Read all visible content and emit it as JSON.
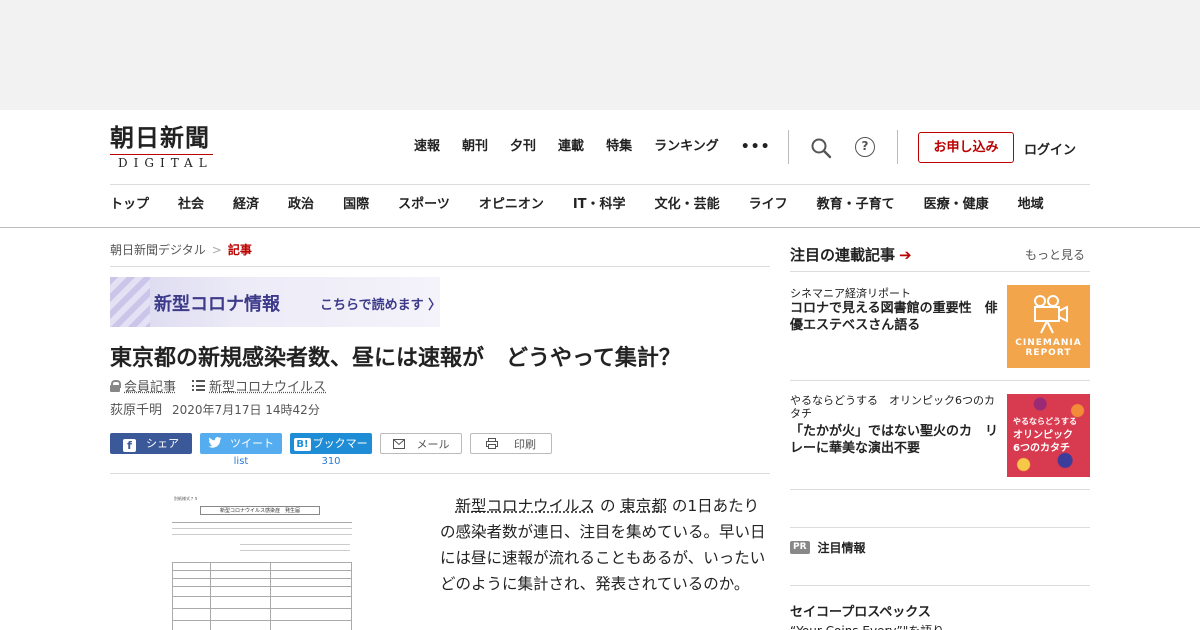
{
  "header": {
    "logo_kanji": "朝日新聞",
    "logo_sub": "DIGITAL",
    "top_nav": [
      "速報",
      "朝刊",
      "夕刊",
      "連載",
      "特集",
      "ランキング"
    ],
    "more_label": "•••",
    "help_label": "?",
    "subscribe_label": "お申し込み",
    "login_label": "ログイン"
  },
  "category_nav": [
    "トップ",
    "社会",
    "経済",
    "政治",
    "国際",
    "スポーツ",
    "オピニオン",
    "IT・科学",
    "文化・芸能",
    "ライフ",
    "教育・子育て",
    "医療・健康",
    "地域"
  ],
  "breadcrumb": {
    "home": "朝日新聞デジタル",
    "sep": ">",
    "current": "記事"
  },
  "banner": {
    "title": "新型コロナ情報",
    "link": "こちらで読めます 〉"
  },
  "article": {
    "title": "東京都の新規感染者数、昼には速報が　どうやって集計？",
    "member_label": "会員記事",
    "topic_label": "新型コロナウイルス",
    "author": "荻原千明",
    "date": "2020年7月17日 14時42分",
    "body_parts": {
      "p1": "新型コロナウイルス",
      "p2": " の ",
      "p3": "東京都",
      "p4": " の1日あたりの感染者数が連日、注目を集めている。早い日には昼に速報が流れることもあるが、いったいどのように集計され、発表されているのか。"
    }
  },
  "share": {
    "facebook": "シェア",
    "twitter": "ツイート",
    "hatena": "ブックマーク",
    "hatena_badge": "B!",
    "mail": "メール",
    "print": "印刷",
    "twitter_count": "list",
    "hatena_count": "310"
  },
  "figure": {
    "doc_header_small": "別紙様式７５",
    "doc_title": "新型コロナウイルス感染症　発生届"
  },
  "sidebar": {
    "title": "注目の連載記事",
    "more": "もっと見る",
    "items": [
      {
        "category": "シネマニア経済リポート",
        "headline": "コロナで見える図書館の重要性　俳優エステベスさん語る",
        "thumb_label": "CINEMANIA REPORT"
      },
      {
        "category": "やるならどうする　オリンピック6つのカタチ",
        "headline": "「たかが火」ではない聖火のカ　リレーに華美な演出不要",
        "thumb_label_1": "やるならどうする",
        "thumb_label_2": "オリンピック",
        "thumb_label_3": "6つのカタチ"
      }
    ],
    "pr_badge": "PR",
    "pr_title": "注目情報",
    "sponsor_title": "セイコープロスペックス",
    "sponsor_sub": "“Your Coins Every”\"を語り"
  },
  "colors": {
    "brand_red": "#b00000",
    "facebook": "#3b5998",
    "twitter": "#55acee",
    "hatena": "#1f8dd6"
  }
}
